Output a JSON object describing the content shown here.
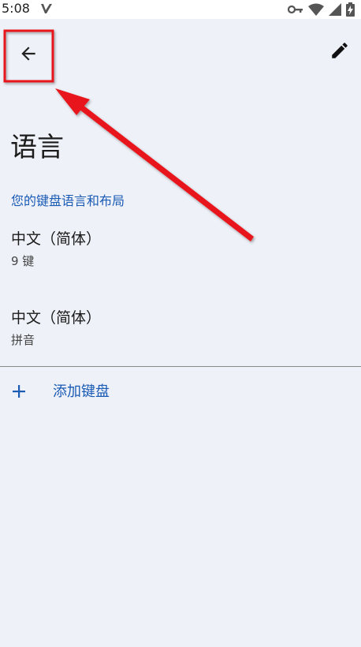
{
  "status_bar": {
    "time": "5:08",
    "icons": [
      "v-logo-icon",
      "key-icon",
      "wifi-icon",
      "signal-icon",
      "battery-charging-icon"
    ]
  },
  "toolbar": {
    "back_icon": "arrow-back-icon",
    "edit_icon": "pencil-icon"
  },
  "page": {
    "title": "语言",
    "section_header": "您的键盘语言和布局"
  },
  "keyboards": [
    {
      "title": "中文（简体）",
      "subtitle": "9 键"
    },
    {
      "title": "中文（简体）",
      "subtitle": "拼音"
    }
  ],
  "add_keyboard": {
    "label": "添加键盘",
    "icon": "plus-icon"
  },
  "colors": {
    "accent": "#1a5bb5",
    "background": "#eef1f7",
    "annotation": "#e8141a"
  }
}
